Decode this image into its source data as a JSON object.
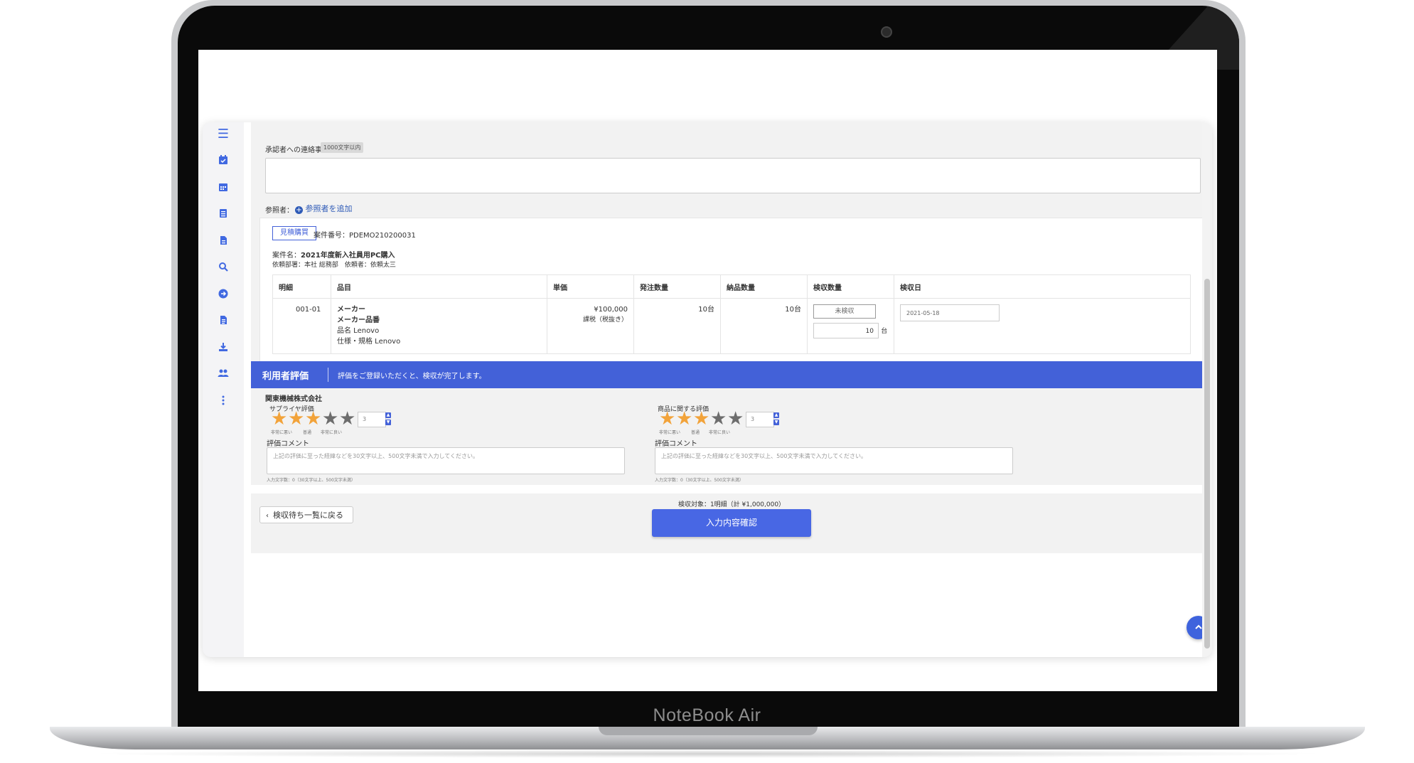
{
  "device": {
    "brand": "NoteBook Air"
  },
  "sidebar": {
    "icons": [
      "menu-icon",
      "calendar-check-icon",
      "calendar-icon",
      "list-icon",
      "file-icon",
      "search-icon",
      "arrow-circle-right-icon",
      "document-icon",
      "download-icon",
      "users-icon",
      "more-vertical-icon"
    ]
  },
  "approver_note": {
    "label": "承認者への連絡事項",
    "limit_chip": "1000文字以内",
    "value": ""
  },
  "reference": {
    "label": "参照者：",
    "add_link": "参照者を追加"
  },
  "order": {
    "badge": "見積購買",
    "case_number": "案件番号：PDEMO210200031",
    "case_name_label": "案件名：",
    "case_name": "2021年度新入社員用PC購入",
    "requester_info": "依頼部署：本社 総務部　依頼者：依頼太三",
    "columns": [
      "明細",
      "品目",
      "単価",
      "発注数量",
      "納品数量",
      "検収数量",
      "検収日"
    ],
    "rows": [
      {
        "line_no": "001-01",
        "item_maker": "メーカー",
        "item_maker_code": "メーカー品番",
        "item_name": "品名 Lenovo",
        "item_spec": "仕様・規格 Lenovo",
        "unit_price": "¥100,000",
        "tax_note": "課税（税抜き）",
        "order_qty": "10台",
        "delivered_qty": "10台",
        "inspection_status": "未検収",
        "inspection_qty": "10",
        "inspection_unit": "台",
        "inspection_date": "2021-05-18"
      }
    ]
  },
  "evaluation": {
    "banner_title": "利用者評価",
    "banner_message": "評価をご登録いただくと、検収が完了します。",
    "supplier_name": "関東機械株式会社",
    "blocks": [
      {
        "title": "サプライヤ評価",
        "rating": 3,
        "max": 5,
        "value": "3",
        "scale_labels": [
          "非常に悪い",
          "普通",
          "非常に良い"
        ],
        "comment_label": "評価コメント",
        "comment_placeholder": "上記の評価に至った経緯などを30文字以上、500文字未満で入力してください。",
        "char_count": "入力文字数：0（30文字以上、500文字未満）"
      },
      {
        "title": "商品に関する評価",
        "rating": 3,
        "max": 5,
        "value": "3",
        "scale_labels": [
          "非常に悪い",
          "普通",
          "非常に良い"
        ],
        "comment_label": "評価コメント",
        "comment_placeholder": "上記の評価に至った経緯などを30文字以上、500文字未満で入力してください。",
        "char_count": "入力文字数：0（30文字以上、500文字未満）"
      }
    ]
  },
  "footer": {
    "back_label": "検収待ち一覧に戻る",
    "summary": "検収対象：1明細（計 ¥1,000,000）",
    "confirm_label": "入力内容確認"
  },
  "colors": {
    "accent": "#4361d8",
    "star": "#f2a33a",
    "star_off": "#6d6d6d"
  }
}
